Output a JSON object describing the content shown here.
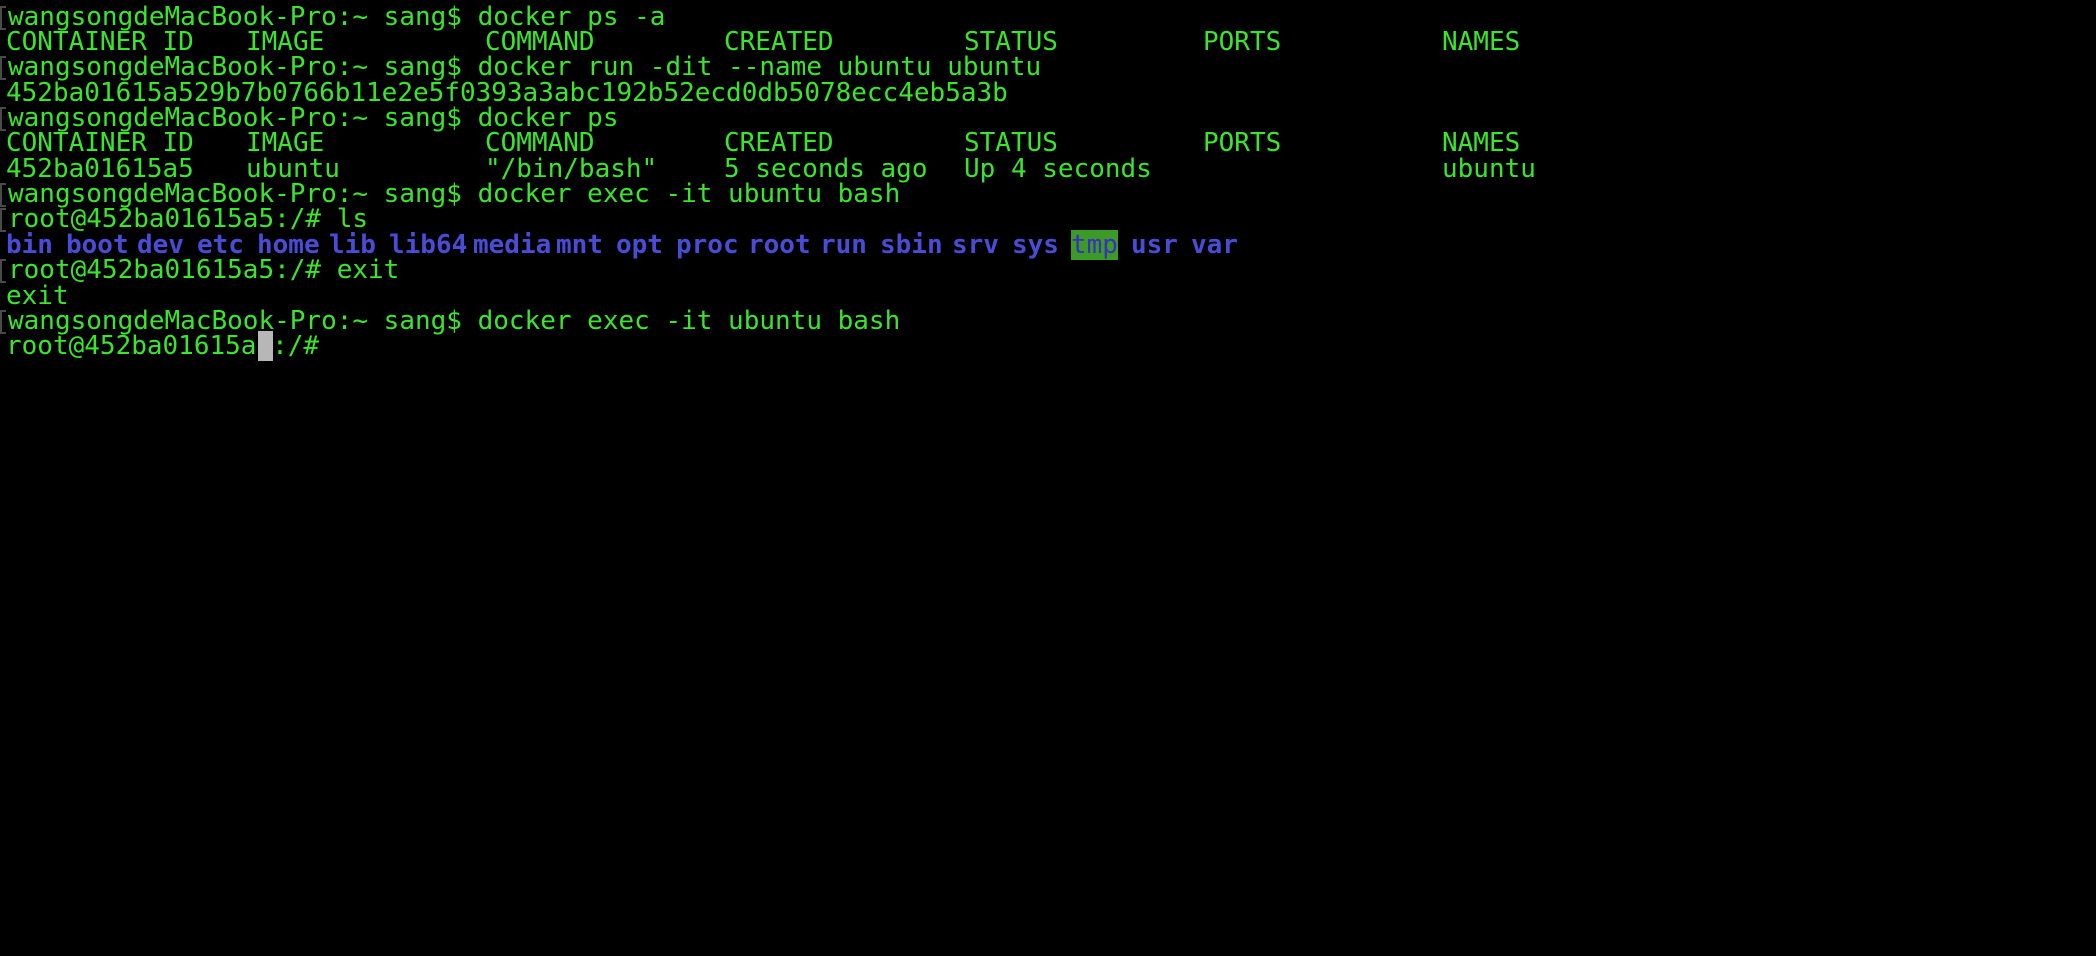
{
  "terminal": {
    "colors": {
      "background": "#000000",
      "text": "#39e62b",
      "directory": "#4a4bd6",
      "sticky_dir_bg": "#3c9a26",
      "cursor": "#b7b7b7"
    },
    "line1": "wangsongdeMacBook-Pro:~ sang$ docker ps -a",
    "headers": [
      "CONTAINER ID",
      "IMAGE",
      "COMMAND",
      "CREATED",
      "STATUS",
      "PORTS",
      "NAMES"
    ],
    "line3": "wangsongdeMacBook-Pro:~ sang$ docker run -dit --name ubuntu ubuntu",
    "line4": "452ba01615a529b7b0766b11e2e5f0393a3abc192b52ecd0db5078ecc4eb5a3b",
    "line5": "wangsongdeMacBook-Pro:~ sang$ docker ps",
    "row": {
      "container_id": "452ba01615a5",
      "image": "ubuntu",
      "command": "\"/bin/bash\"",
      "created": "5 seconds ago",
      "status": "Up 4 seconds",
      "ports": "",
      "names": "ubuntu"
    },
    "line8": "wangsongdeMacBook-Pro:~ sang$ docker exec -it ubuntu bash",
    "line9": "root@452ba01615a5:/# ls",
    "ls_dirs": [
      "bin",
      "boot",
      "dev",
      "etc",
      "home",
      "lib",
      "lib64",
      "media",
      "mnt",
      "opt",
      "proc",
      "root",
      "run",
      "sbin",
      "srv",
      "sys",
      "tmp",
      "usr",
      "var"
    ],
    "line11": "root@452ba01615a5:/# exit",
    "line12": "exit",
    "line13": "wangsongdeMacBook-Pro:~ sang$ docker exec -it ubuntu bash",
    "line14": "root@452ba01615a5:/# "
  }
}
